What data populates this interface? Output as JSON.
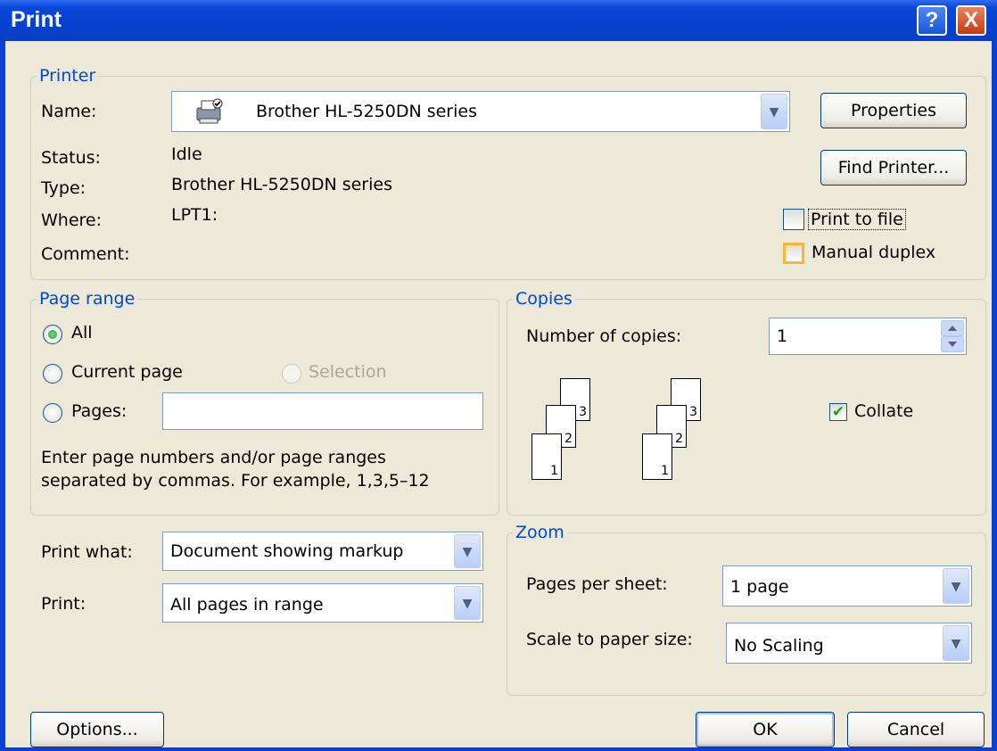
{
  "window": {
    "title": "Print",
    "help_glyph": "?",
    "close_glyph": "X"
  },
  "printer": {
    "legend": "Printer",
    "name_label": "Name:",
    "name_value": "Brother HL-5250DN series",
    "status_label": "Status:",
    "status_value": "Idle",
    "type_label": "Type:",
    "type_value": "Brother HL-5250DN series",
    "where_label": "Where:",
    "where_value": "LPT1:",
    "comment_label": "Comment:",
    "properties_button": "Properties",
    "find_printer_button": "Find Printer...",
    "print_to_file": {
      "label": "Print to file",
      "checked": false
    },
    "manual_duplex": {
      "label": "Manual duplex",
      "checked": false
    }
  },
  "page_range": {
    "legend": "Page range",
    "all_label": "All",
    "current_page_label": "Current page",
    "selection_label": "Selection",
    "pages_label": "Pages:",
    "pages_value": "",
    "hint_line1": "Enter page numbers and/or page ranges",
    "hint_line2": "separated by commas.  For example, 1,3,5–12",
    "selected": "All"
  },
  "copies": {
    "legend": "Copies",
    "number_label": "Number of copies:",
    "number_value": "1",
    "collate": {
      "label": "Collate",
      "checked": true
    },
    "page_numbers": [
      "1",
      "2",
      "3"
    ]
  },
  "print_what": {
    "label": "Print what:",
    "value": "Document showing markup"
  },
  "print": {
    "label": "Print:",
    "value": "All pages in range"
  },
  "zoom": {
    "legend": "Zoom",
    "pages_per_sheet_label": "Pages per sheet:",
    "pages_per_sheet_value": "1 page",
    "scale_label": "Scale to paper size:",
    "scale_value": "No Scaling"
  },
  "footer": {
    "options_button": "Options...",
    "ok_button": "OK",
    "cancel_button": "Cancel"
  },
  "colors": {
    "title_bar": "#0642d0",
    "dialog_bg": "#ece9d8",
    "group_label": "#0046d5",
    "check_green": "#21a121"
  },
  "icons": {
    "printer": "printer-icon",
    "dropdown": "chevron-down-icon",
    "spinner": "spinner-arrows-icon"
  }
}
